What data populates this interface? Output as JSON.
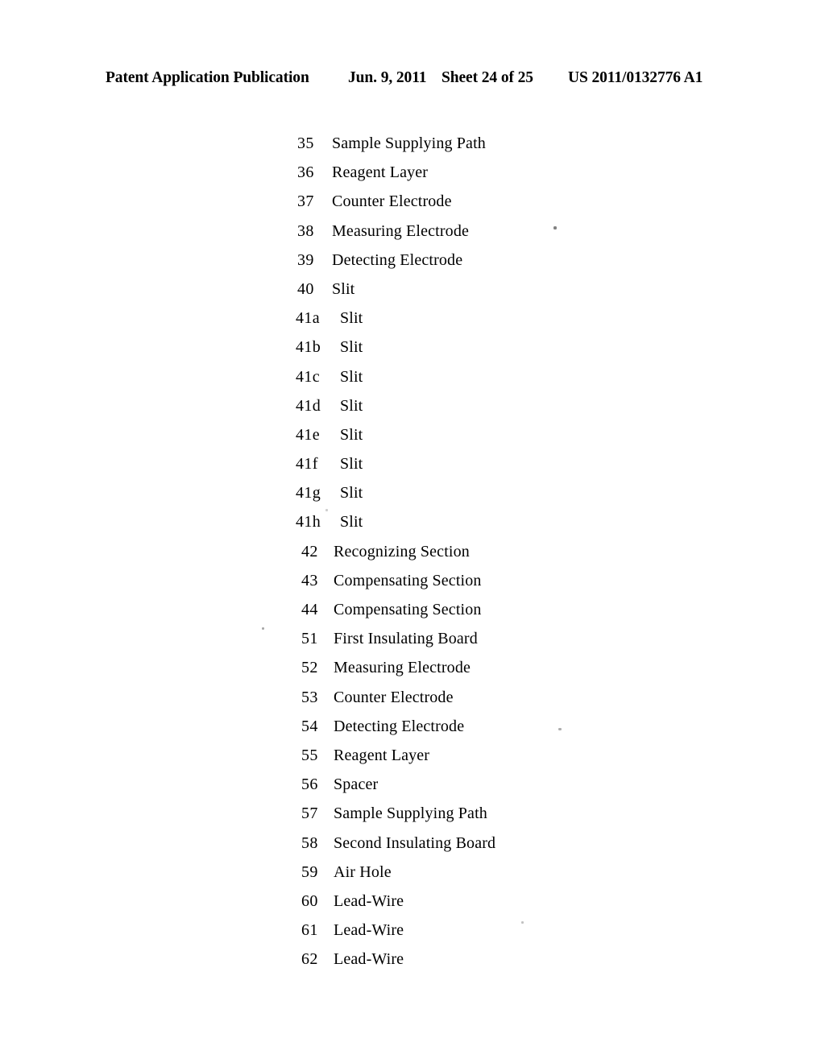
{
  "header": {
    "publication": "Patent Application Publication",
    "date": "Jun. 9, 2011",
    "sheet": "Sheet 24 of 25",
    "doc_number": "US 2011/0132776 A1"
  },
  "reference_list": [
    {
      "num": "35",
      "label": "Sample Supplying Path",
      "group": "a"
    },
    {
      "num": "36",
      "label": "Reagent Layer",
      "group": "a"
    },
    {
      "num": "37",
      "label": "Counter Electrode",
      "group": "a"
    },
    {
      "num": "38",
      "label": "Measuring Electrode",
      "group": "a"
    },
    {
      "num": "39",
      "label": "Detecting Electrode",
      "group": "a"
    },
    {
      "num": "40",
      "label": "Slit",
      "group": "a"
    },
    {
      "num": "41a",
      "label": "Slit",
      "group": "b"
    },
    {
      "num": "41b",
      "label": "Slit",
      "group": "b"
    },
    {
      "num": "41c",
      "label": "Slit",
      "group": "b"
    },
    {
      "num": "41d",
      "label": "Slit",
      "group": "b"
    },
    {
      "num": "41e",
      "label": "Slit",
      "group": "b"
    },
    {
      "num": "41f",
      "label": "Slit",
      "group": "b"
    },
    {
      "num": "41g",
      "label": "Slit",
      "group": "b"
    },
    {
      "num": "41h",
      "label": "Slit",
      "group": "b"
    },
    {
      "num": "42",
      "label": "Recognizing Section",
      "group": "c"
    },
    {
      "num": "43",
      "label": "Compensating Section",
      "group": "c"
    },
    {
      "num": "44",
      "label": "Compensating Section",
      "group": "c"
    },
    {
      "num": "51",
      "label": "First Insulating Board",
      "group": "c"
    },
    {
      "num": "52",
      "label": "Measuring Electrode",
      "group": "c"
    },
    {
      "num": "53",
      "label": "Counter Electrode",
      "group": "c"
    },
    {
      "num": "54",
      "label": "Detecting Electrode",
      "group": "c"
    },
    {
      "num": "55",
      "label": "Reagent Layer",
      "group": "c"
    },
    {
      "num": "56",
      "label": "Spacer",
      "group": "c"
    },
    {
      "num": "57",
      "label": "Sample Supplying Path",
      "group": "c"
    },
    {
      "num": "58",
      "label": "Second Insulating Board",
      "group": "c"
    },
    {
      "num": "59",
      "label": "Air Hole",
      "group": "c"
    },
    {
      "num": "60",
      "label": "Lead-Wire",
      "group": "c"
    },
    {
      "num": "61",
      "label": "Lead-Wire",
      "group": "c"
    },
    {
      "num": "62",
      "label": "Lead-Wire",
      "group": "c"
    }
  ],
  "colors": {
    "page_background": "#ffffff",
    "text": "#000000"
  }
}
